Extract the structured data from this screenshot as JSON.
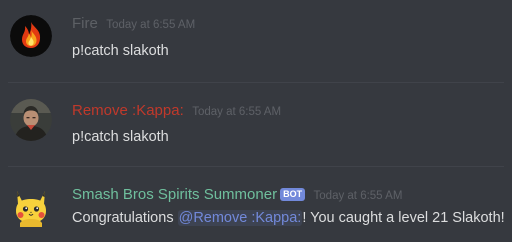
{
  "colors": {
    "background": "#36393f",
    "message_text": "#dcddde",
    "timestamp": "#5e6167",
    "bot_tag": "#7289da",
    "mention": "#7289da"
  },
  "messages": [
    {
      "author": "Fire",
      "author_color": "#5d6065",
      "timestamp": "Today at 6:55 AM",
      "avatar_icon": "fire-icon",
      "content": "p!catch slakoth"
    },
    {
      "author": "Remove :Kappa:",
      "author_color": "#c0392b",
      "timestamp": "Today at 6:55 AM",
      "avatar_icon": "user-avatar-icon",
      "content": "p!catch slakoth"
    },
    {
      "author": "Smash Bros Spirits Summoner",
      "author_color": "#6fbf9d",
      "bot_tag": "BOT",
      "timestamp": "Today at 6:55 AM",
      "avatar_icon": "pikachu-icon",
      "content_before": "Congratulations ",
      "mention": "@Remove :Kappa:",
      "content_after": "! You caught a level 21 Slakoth!"
    }
  ]
}
